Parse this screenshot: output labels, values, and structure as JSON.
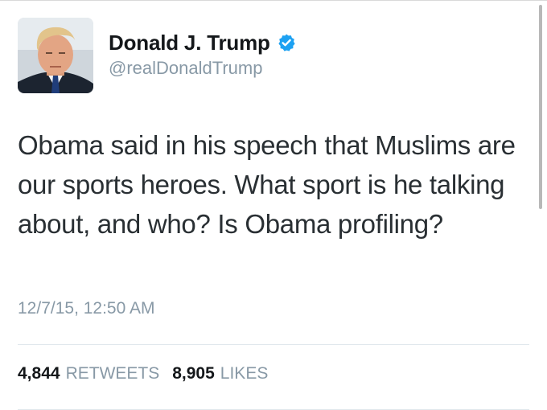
{
  "user": {
    "name": "Donald J. Trump",
    "handle": "@realDonaldTrump",
    "verified": true,
    "verified_icon": "verified-badge-icon",
    "verified_color": "#1da1f2"
  },
  "tweet": {
    "text": "Obama said in his speech that Muslims are our sports heroes. What sport is he talking about, and who? Is Obama profiling?",
    "timestamp": "12/7/15, 12:50 AM"
  },
  "stats": {
    "retweets_count": "4,844",
    "retweets_label": "RETWEETS",
    "likes_count": "8,905",
    "likes_label": "LIKES"
  }
}
